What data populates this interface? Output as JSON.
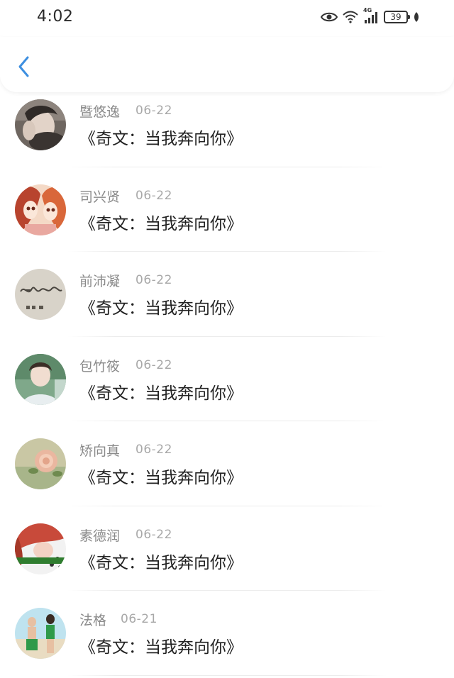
{
  "status_bar": {
    "time": "4:02",
    "network": "4G",
    "battery": "39"
  },
  "nav": {
    "back_icon": "chevron-left-icon",
    "accent": "#3d8fe0"
  },
  "comments": [
    {
      "name": "暨悠逸",
      "date": "06-22",
      "title": "《奇文：当我奔向你》"
    },
    {
      "name": "司兴贤",
      "date": "06-22",
      "title": "《奇文：当我奔向你》"
    },
    {
      "name": "前沛凝",
      "date": "06-22",
      "title": "《奇文：当我奔向你》"
    },
    {
      "name": "包竹筱",
      "date": "06-22",
      "title": "《奇文：当我奔向你》"
    },
    {
      "name": "矫向真",
      "date": "06-22",
      "title": "《奇文：当我奔向你》"
    },
    {
      "name": "素德润",
      "date": "06-22",
      "title": "《奇文：当我奔向你》"
    },
    {
      "name": "法格",
      "date": "06-21",
      "title": "《奇文：当我奔向你》"
    }
  ]
}
